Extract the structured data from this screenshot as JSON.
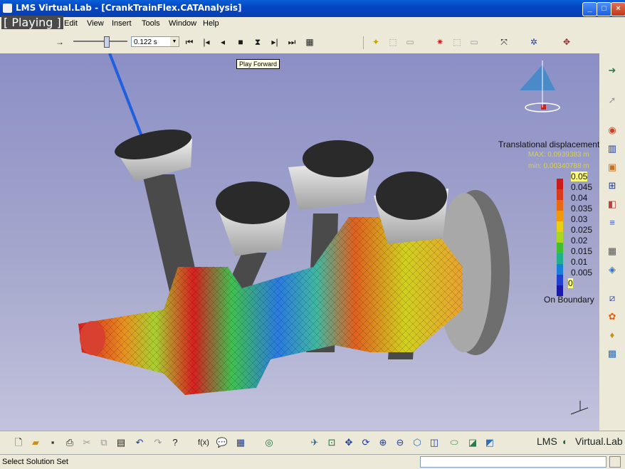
{
  "window": {
    "title": "LMS Virtual.Lab - [CrankTrainFlex.CATAnalysis]",
    "playing_label": "[ Playing ]"
  },
  "menu": [
    "Edit",
    "View",
    "Insert",
    "Tools",
    "Window",
    "Help"
  ],
  "animation": {
    "time_value": "0.122 s",
    "tooltip": "Play Forward"
  },
  "legend": {
    "title": "Translational displacement",
    "max_label": "MAX: 0.0939383 m",
    "min_label": "min: 0.00340788 m",
    "scale": [
      "0.05",
      "0.045",
      "0.04",
      "0.035",
      "0.03",
      "0.025",
      "0.02",
      "0.015",
      "0.01",
      "0.005",
      "0"
    ],
    "colors": [
      "#cc1a1a",
      "#d83a1a",
      "#e86a10",
      "#f09a08",
      "#e8d010",
      "#a8d820",
      "#40c030",
      "#20b090",
      "#1880d8",
      "#2040d0",
      "#1a1aa8"
    ],
    "boundary": "On Boundary"
  },
  "branding": {
    "left": "LMS",
    "right": "Virtual.Lab"
  },
  "status": {
    "text": "Select Solution Set"
  }
}
